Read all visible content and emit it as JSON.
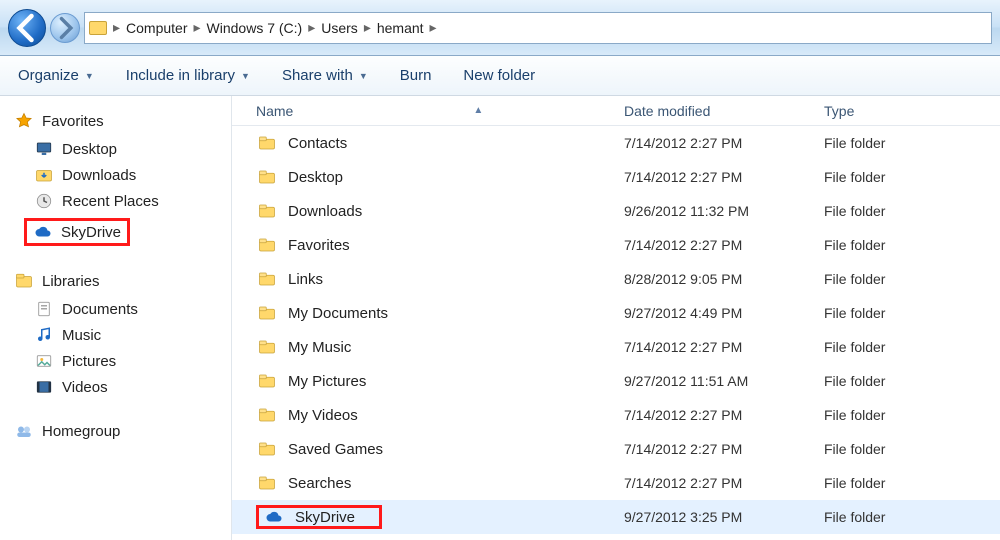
{
  "breadcrumb": [
    "Computer",
    "Windows 7 (C:)",
    "Users",
    "hemant"
  ],
  "toolbar": {
    "organize": "Organize",
    "include": "Include in library",
    "share": "Share with",
    "burn": "Burn",
    "newfolder": "New folder"
  },
  "sidebar": {
    "favorites_title": "Favorites",
    "favorites": [
      {
        "label": "Desktop",
        "icon": "monitor"
      },
      {
        "label": "Downloads",
        "icon": "folder-down"
      },
      {
        "label": "Recent Places",
        "icon": "recent"
      },
      {
        "label": "SkyDrive",
        "icon": "cloud",
        "highlight": true
      }
    ],
    "libraries_title": "Libraries",
    "libraries": [
      {
        "label": "Documents",
        "icon": "doc"
      },
      {
        "label": "Music",
        "icon": "music"
      },
      {
        "label": "Pictures",
        "icon": "pic"
      },
      {
        "label": "Videos",
        "icon": "video"
      }
    ],
    "homegroup": "Homegroup"
  },
  "columns": {
    "name": "Name",
    "date": "Date modified",
    "type": "Type"
  },
  "rows": [
    {
      "name": "Contacts",
      "date": "7/14/2012 2:27 PM",
      "type": "File folder",
      "icon": "folder"
    },
    {
      "name": "Desktop",
      "date": "7/14/2012 2:27 PM",
      "type": "File folder",
      "icon": "folder"
    },
    {
      "name": "Downloads",
      "date": "9/26/2012 11:32 PM",
      "type": "File folder",
      "icon": "folder"
    },
    {
      "name": "Favorites",
      "date": "7/14/2012 2:27 PM",
      "type": "File folder",
      "icon": "folder"
    },
    {
      "name": "Links",
      "date": "8/28/2012 9:05 PM",
      "type": "File folder",
      "icon": "folder"
    },
    {
      "name": "My Documents",
      "date": "9/27/2012 4:49 PM",
      "type": "File folder",
      "icon": "folder"
    },
    {
      "name": "My Music",
      "date": "7/14/2012 2:27 PM",
      "type": "File folder",
      "icon": "folder"
    },
    {
      "name": "My Pictures",
      "date": "9/27/2012 11:51 AM",
      "type": "File folder",
      "icon": "folder"
    },
    {
      "name": "My Videos",
      "date": "7/14/2012 2:27 PM",
      "type": "File folder",
      "icon": "folder"
    },
    {
      "name": "Saved Games",
      "date": "7/14/2012 2:27 PM",
      "type": "File folder",
      "icon": "folder"
    },
    {
      "name": "Searches",
      "date": "7/14/2012 2:27 PM",
      "type": "File folder",
      "icon": "folder"
    },
    {
      "name": "SkyDrive",
      "date": "9/27/2012 3:25 PM",
      "type": "File folder",
      "icon": "cloud",
      "highlight": true,
      "selected": true
    }
  ]
}
